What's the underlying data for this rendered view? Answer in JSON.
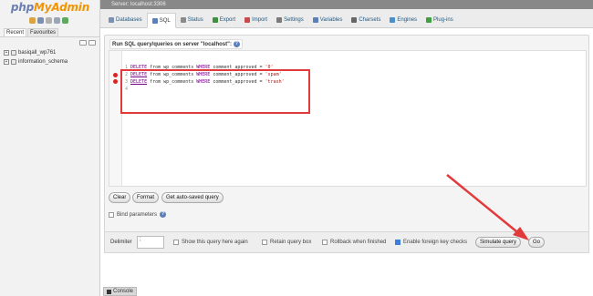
{
  "nav": {
    "logo_php": "php",
    "logo_myadmin": "MyAdmin",
    "tab_recent": "Recent",
    "tab_favourites": "Favourites",
    "databases": [
      {
        "name": "basiqall_wp761"
      },
      {
        "name": "information_schema"
      }
    ]
  },
  "topbar": {
    "server_label": "Server: localhost:3306"
  },
  "tabs": [
    {
      "label": "Databases",
      "icon": "databases-icon",
      "color": "#7b8fb0"
    },
    {
      "label": "SQL",
      "icon": "sql-icon",
      "color": "#5b7fb9"
    },
    {
      "label": "Status",
      "icon": "status-icon",
      "color": "#8a8a8a"
    },
    {
      "label": "Export",
      "icon": "export-icon",
      "color": "#3f8f3f"
    },
    {
      "label": "Import",
      "icon": "import-icon",
      "color": "#c94a4a"
    },
    {
      "label": "Settings",
      "icon": "settings-icon",
      "color": "#7a7a7a"
    },
    {
      "label": "Variables",
      "icon": "variables-icon",
      "color": "#5b7fb9"
    },
    {
      "label": "Charsets",
      "icon": "charsets-icon",
      "color": "#666666"
    },
    {
      "label": "Engines",
      "icon": "engines-icon",
      "color": "#4a8fc9"
    },
    {
      "label": "Plug-ins",
      "icon": "plugins-icon",
      "color": "#3f9f3f"
    }
  ],
  "query": {
    "legend": "Run SQL query/queries on server \"localhost\":",
    "lines": [
      {
        "no": "1",
        "kw": "DELETE",
        "mid": " from wp_comments ",
        "kw2": "WHERE",
        "rest": " comment_approved = ",
        "str": "'0'",
        "error": false
      },
      {
        "no": "2",
        "kw": "DELETE",
        "mid": " from wp_comments ",
        "kw2": "WHERE",
        "rest": " comment_approved = ",
        "str": "'spam'",
        "error": true
      },
      {
        "no": "3",
        "kw": "DELETE",
        "mid": " from wp_comments ",
        "kw2": "WHERE",
        "rest": " comment_approved = ",
        "str": "'trash'",
        "error": true
      },
      {
        "no": "4",
        "kw": "",
        "mid": "",
        "kw2": "",
        "rest": "",
        "str": "",
        "error": false
      }
    ]
  },
  "buttons": {
    "clear": "Clear",
    "format": "Format",
    "get_autosaved": "Get auto-saved query",
    "simulate": "Simulate query",
    "go": "Go"
  },
  "options": {
    "bind_parameters": "Bind parameters",
    "delimiter_label": "Delimiter",
    "delimiter_value": ";",
    "show_query_again": "Show this query here again",
    "retain_query_box": "Retain query box",
    "rollback": "Rollback when finished",
    "foreign_key_checks": "Enable foreign key checks"
  },
  "console": {
    "label": "Console"
  },
  "colors": {
    "annotation_red": "#e23a3a",
    "accent_blue": "#235a81"
  }
}
